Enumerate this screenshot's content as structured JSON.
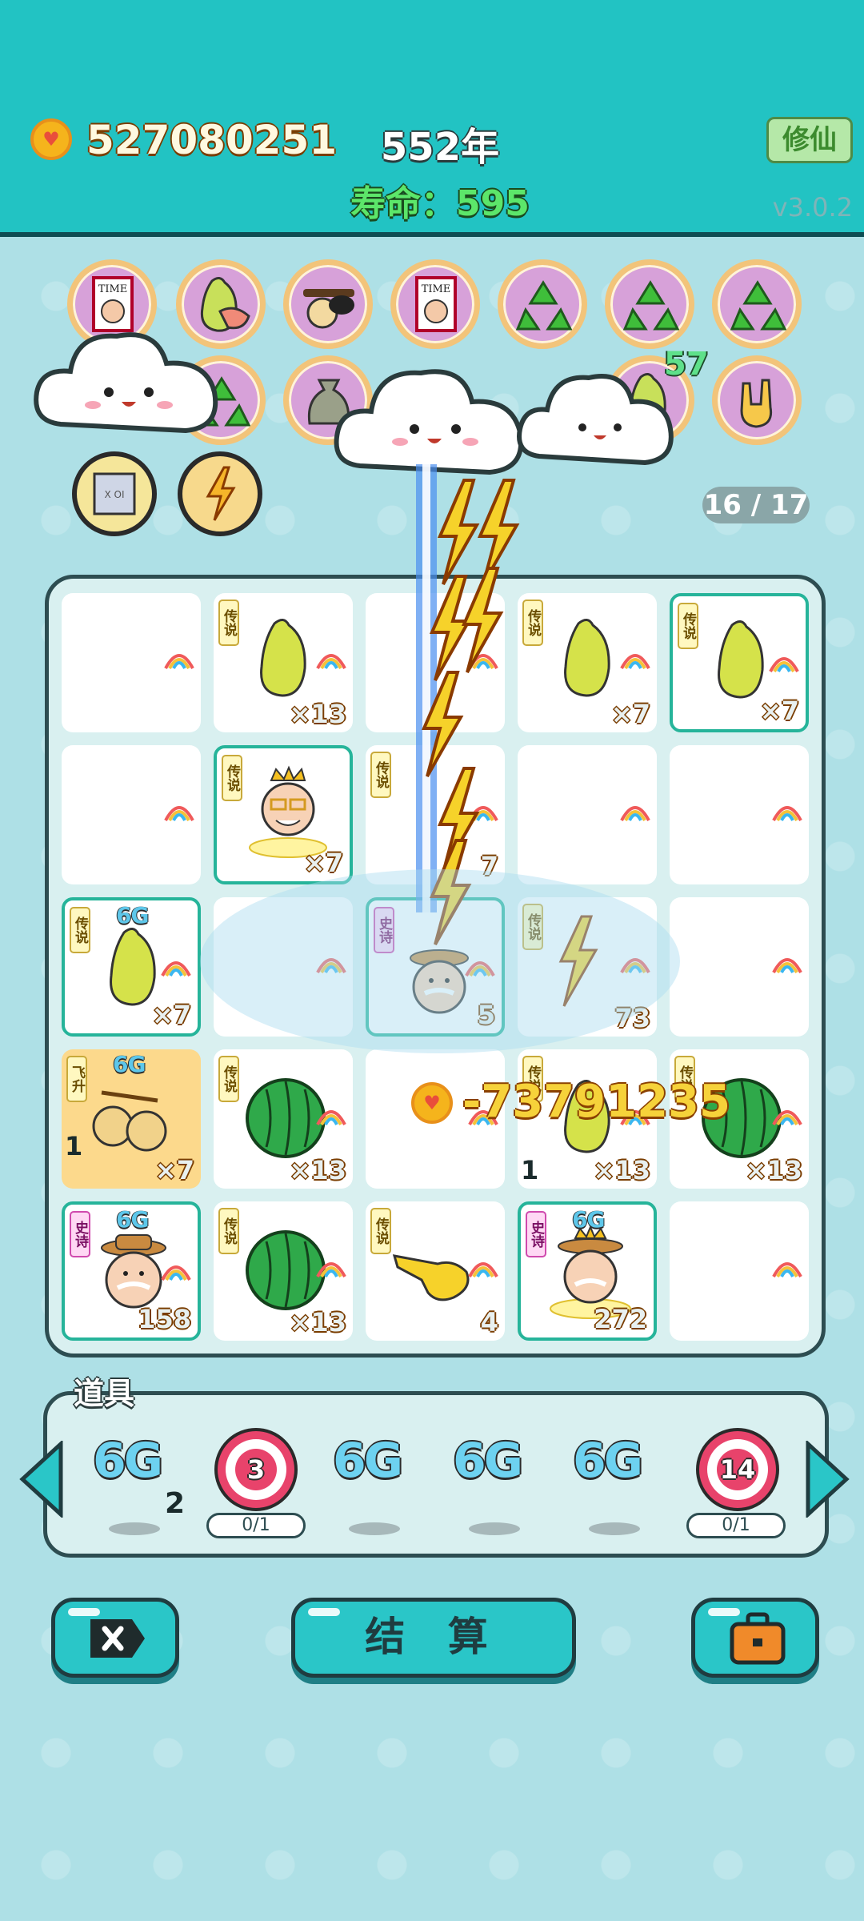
{
  "hud": {
    "coins": "527080251",
    "year": "552年",
    "lifespan": "寿命：595",
    "cultivate_button": "修仙",
    "version": "v3.0.2"
  },
  "relics": {
    "row1": [
      "time-magazine-icon",
      "pomelo-icon",
      "sunglasses-icon",
      "time-magazine-icon",
      "recycle-icon",
      "recycle-icon",
      "recycle-icon"
    ],
    "row2": [
      "recycle-icon",
      "money-bag-icon",
      "pomelo-icon",
      "rock-hand-icon"
    ],
    "row3": [
      "microchip-icon",
      "lightning-icon"
    ],
    "badge": "57"
  },
  "slots": {
    "counter": "16 / 17"
  },
  "board": {
    "tag_legend": "传说",
    "tag_epic": "史诗",
    "tag_ascend": "飞升",
    "cells": [
      {
        "item": "empty"
      },
      {
        "item": "pomelo",
        "tag": "传说",
        "count": "×13"
      },
      {
        "item": "empty"
      },
      {
        "item": "pomelo",
        "tag": "传说",
        "count": "×7"
      },
      {
        "item": "pomelo",
        "tag": "传说",
        "count": "×7"
      },
      {
        "item": "empty"
      },
      {
        "item": "king-grandpa",
        "tag": "传说",
        "count": "×7"
      },
      {
        "item": "lightning",
        "tag": "传说",
        "count": "7"
      },
      {
        "item": "empty"
      },
      {
        "item": "empty"
      },
      {
        "item": "pomelo",
        "tag": "传说",
        "g6": "6G",
        "count": "×7"
      },
      {
        "item": "empty"
      },
      {
        "item": "farmer",
        "tag": "史诗",
        "count": "5"
      },
      {
        "item": "lightning",
        "tag": "传说",
        "count": "73"
      },
      {
        "item": "empty"
      },
      {
        "item": "golden-fruit",
        "tag": "飞升",
        "g6": "6G",
        "level": "1",
        "count": "×7"
      },
      {
        "item": "watermelon",
        "tag": "传说",
        "count": "×13"
      },
      {
        "item": "empty"
      },
      {
        "item": "pomelo",
        "tag": "传说",
        "level": "1",
        "count": "×13"
      },
      {
        "item": "watermelon",
        "tag": "传说",
        "count": "×13"
      },
      {
        "item": "farmer",
        "tag": "史诗",
        "g6": "6G",
        "count": "158"
      },
      {
        "item": "watermelon",
        "tag": "传说",
        "count": "×13"
      },
      {
        "item": "pointing-hand",
        "tag": "传说",
        "count": "4"
      },
      {
        "item": "king-farmer",
        "tag": "史诗",
        "g6": "6G",
        "count": "272"
      },
      {
        "item": "empty"
      }
    ]
  },
  "damage": {
    "value": "-73791235"
  },
  "props": {
    "title": "道具",
    "items": [
      {
        "type": "6g",
        "label": "6G",
        "sub": "2"
      },
      {
        "type": "target",
        "label": "3",
        "progress": "0/1"
      },
      {
        "type": "6g",
        "label": "6G"
      },
      {
        "type": "6g",
        "label": "6G"
      },
      {
        "type": "6g",
        "label": "6G"
      },
      {
        "type": "target",
        "label": "14",
        "progress": "0/1"
      }
    ]
  },
  "actions": {
    "settle": "结 算"
  },
  "colors": {
    "header": "#22c3c3",
    "background": "#aee0e6",
    "accent_green": "#5ce66a",
    "button": "#2ac6c8"
  }
}
